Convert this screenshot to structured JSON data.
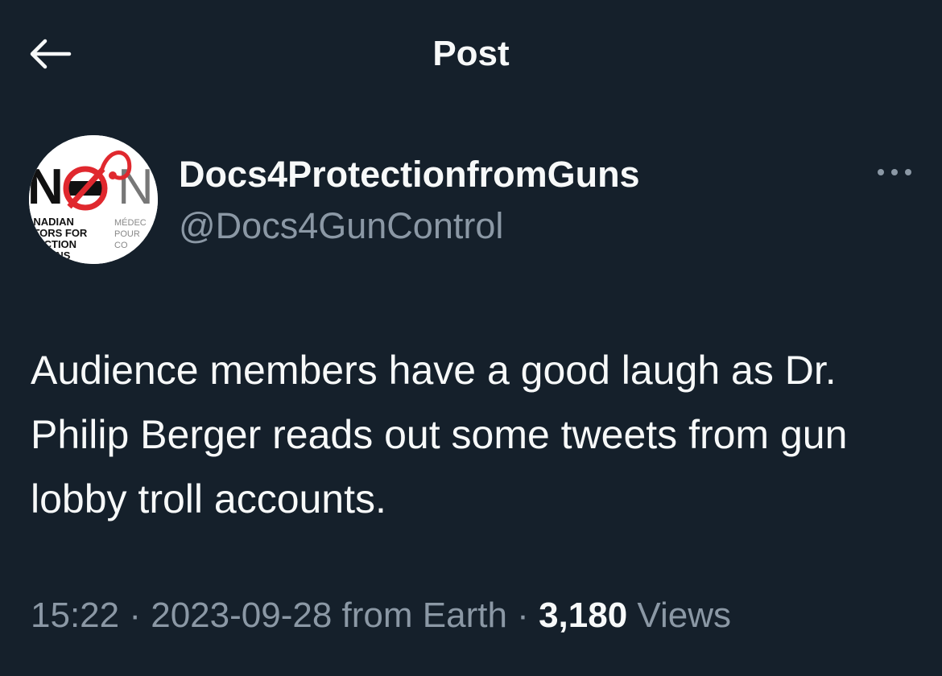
{
  "header": {
    "back_icon": "arrow-left-icon",
    "title": "Post"
  },
  "author": {
    "avatar_icon": "organization-logo",
    "avatar_text": [
      "N",
      "N",
      "ANADIAN",
      "CTORS FOR",
      "TECTION",
      "UNS",
      "MÉDEC",
      "POUR",
      "CO"
    ],
    "display_name": "Docs4ProtectionfromGuns",
    "handle": "@Docs4GunControl",
    "more_icon": "more-horizontal-icon"
  },
  "post": {
    "text": "Audience members have a good laugh as Dr. Philip Berger reads out some tweets from gun lobby troll accounts."
  },
  "meta": {
    "time": "15:22",
    "separator": "·",
    "date": "2023-09-28",
    "source": "from Earth",
    "views_count": "3,180",
    "views_label": "Views"
  },
  "colors": {
    "background": "#15202b",
    "primary_text": "#f7f9f9",
    "secondary_text": "#8b98a5",
    "logo_red": "#e0282e"
  }
}
